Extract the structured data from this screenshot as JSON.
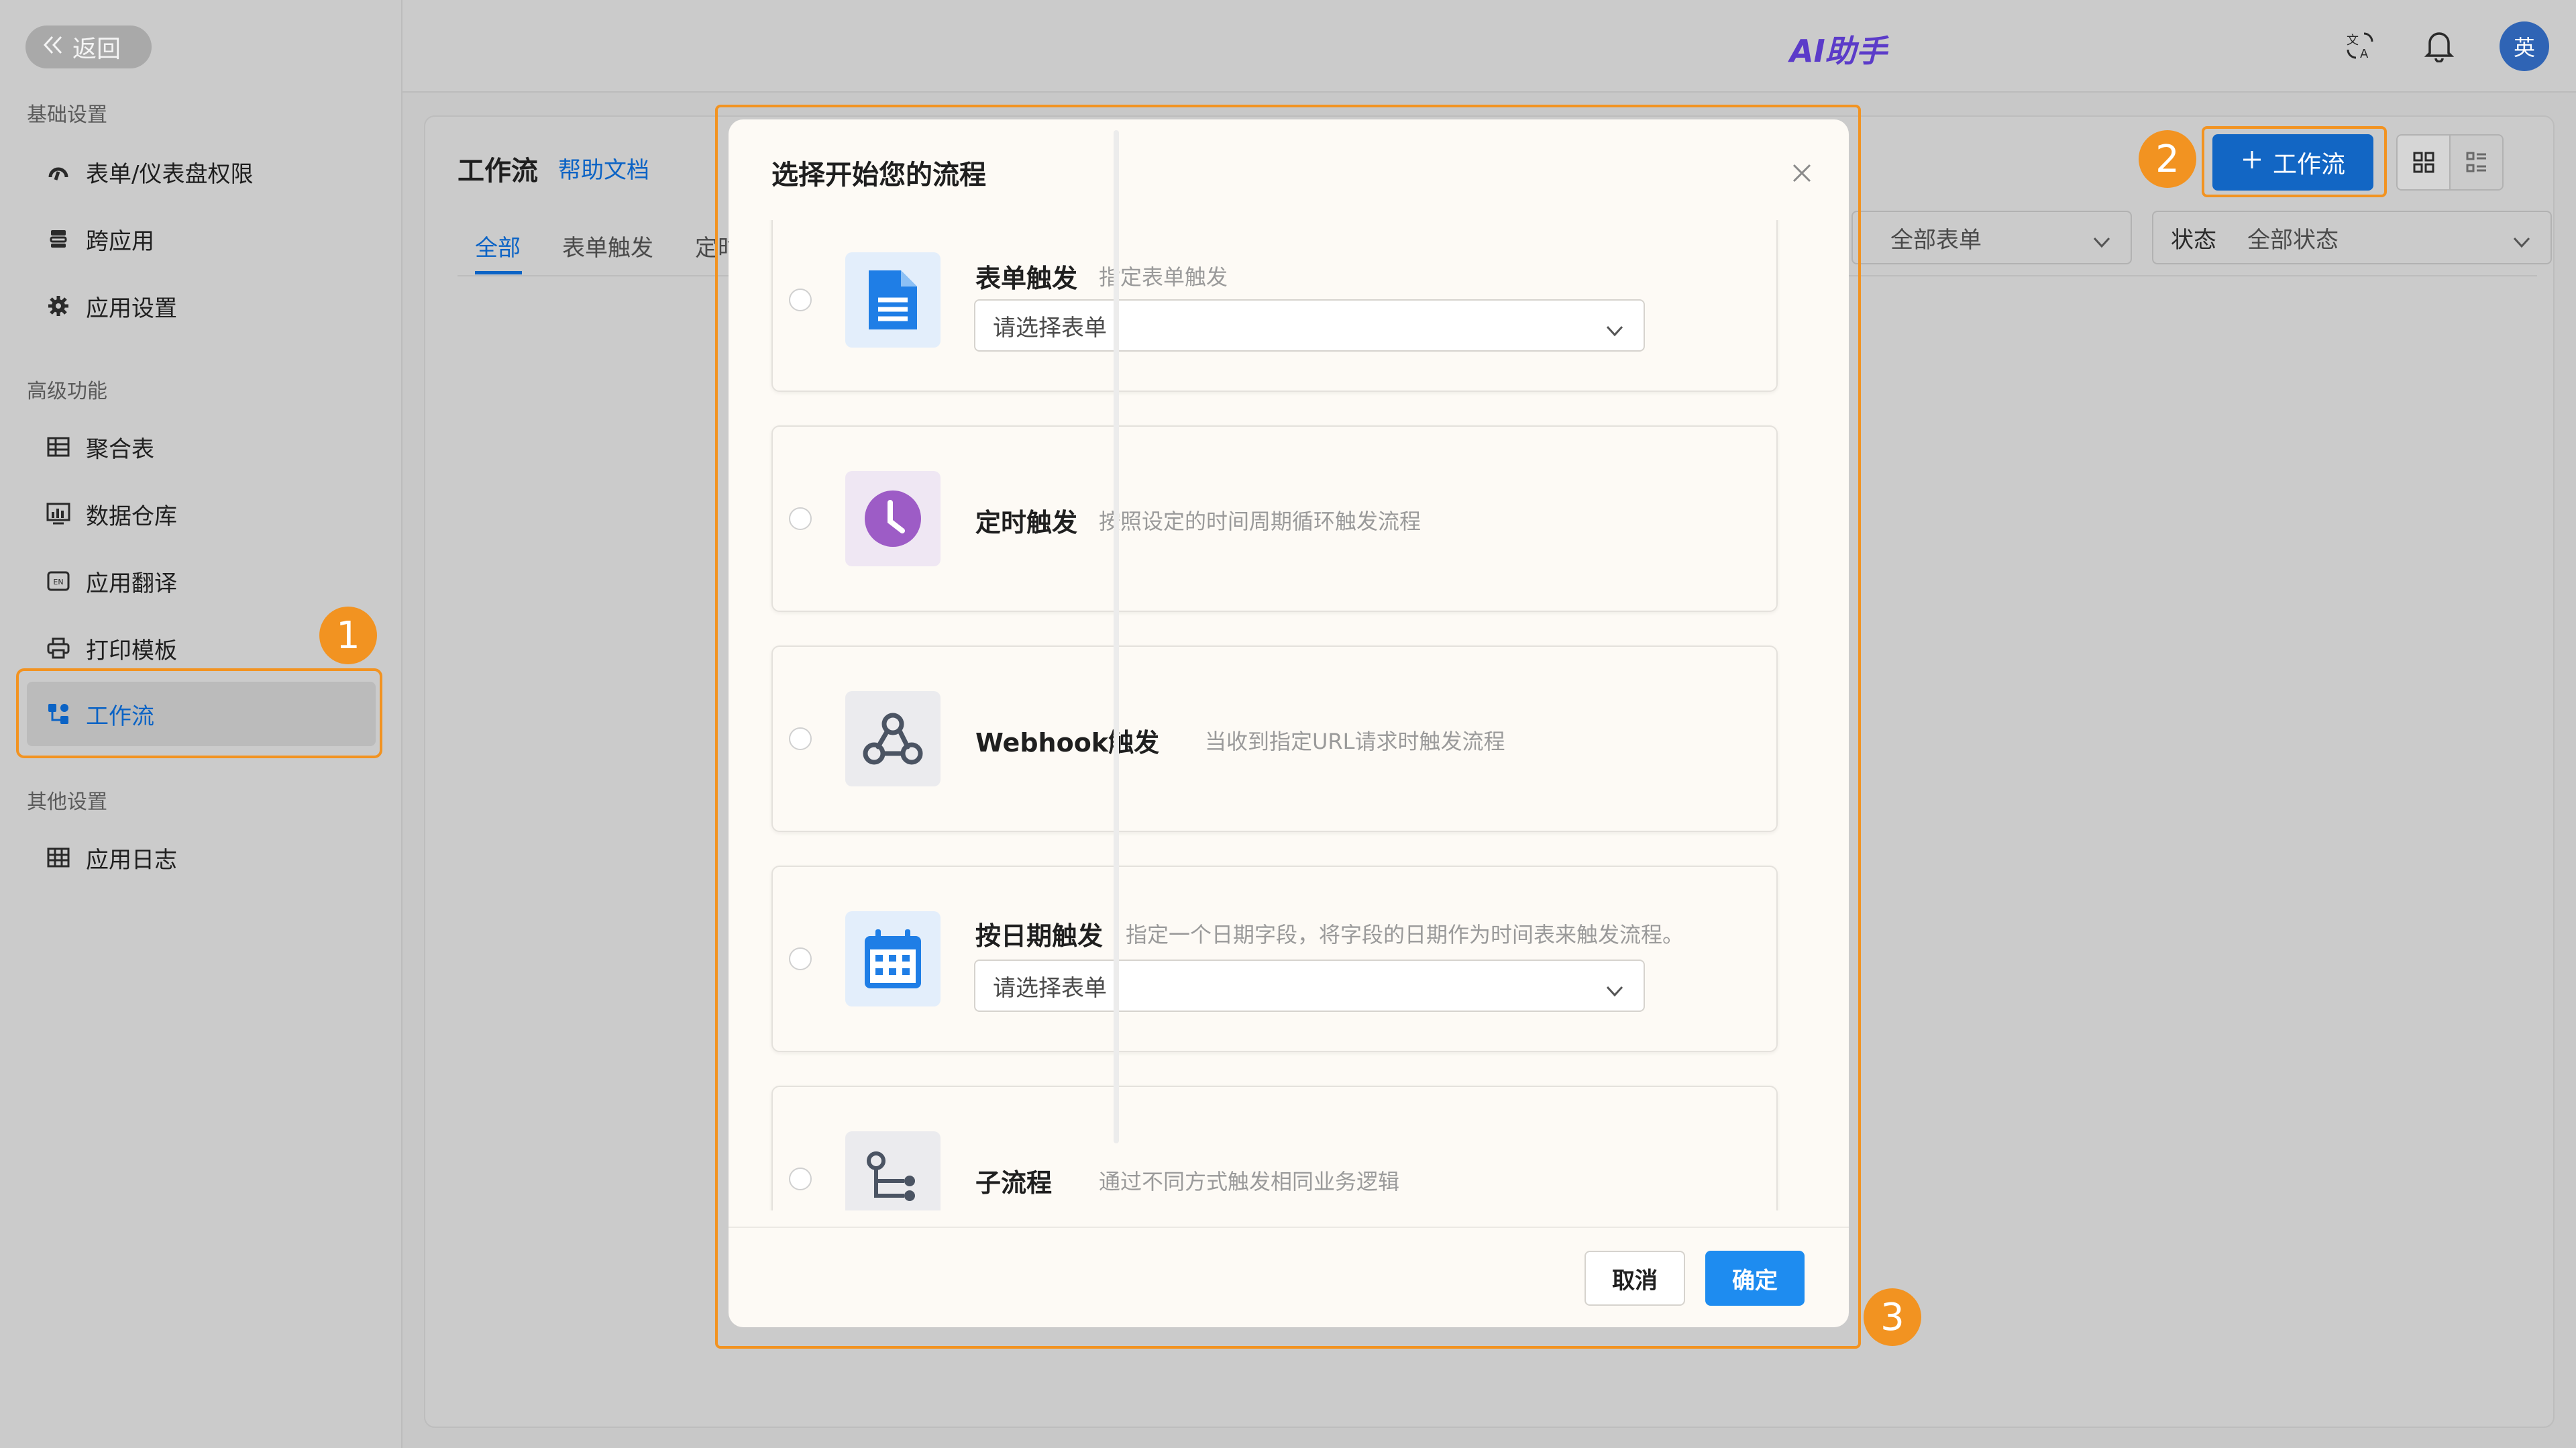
{
  "sidebar": {
    "back_label": "返回",
    "sections": [
      {
        "title": "基础设置"
      },
      {
        "title": "高级功能"
      },
      {
        "title": "其他设置"
      }
    ],
    "items": [
      {
        "label": "表单/仪表盘权限",
        "icon": "permission-icon"
      },
      {
        "label": "跨应用",
        "icon": "cross-app-icon"
      },
      {
        "label": "应用设置",
        "icon": "gear-icon"
      },
      {
        "label": "聚合表",
        "icon": "aggregate-table-icon"
      },
      {
        "label": "数据仓库",
        "icon": "data-warehouse-icon"
      },
      {
        "label": "应用翻译",
        "icon": "translate-icon"
      },
      {
        "label": "打印模板",
        "icon": "printer-icon"
      },
      {
        "label": "工作流",
        "icon": "workflow-icon",
        "active": true
      },
      {
        "label": "应用日志",
        "icon": "log-icon"
      }
    ]
  },
  "topbar": {
    "ai_label": "AI助手",
    "avatar_text": "英"
  },
  "main": {
    "title": "工作流",
    "help_link": "帮助文档",
    "tabs": [
      {
        "label": "全部",
        "active": true
      },
      {
        "label": "表单触发"
      },
      {
        "label": "定时"
      }
    ],
    "filter_form": "全部表单",
    "filter_status_label": "状态",
    "filter_status_value": "全部状态",
    "add_button": "工作流"
  },
  "modal": {
    "title": "选择开始您的流程",
    "options": [
      {
        "name": "表单触发",
        "desc": "指定表单触发",
        "select_placeholder": "请选择表单",
        "icon": "form-document-icon"
      },
      {
        "name": "定时触发",
        "desc": "按照设定的时间周期循环触发流程",
        "icon": "clock-icon"
      },
      {
        "name": "Webhook触发",
        "desc": "当收到指定URL请求时触发流程",
        "icon": "webhook-icon"
      },
      {
        "name": "按日期触发",
        "desc": "指定一个日期字段，将字段的日期作为时间表来触发流程。",
        "select_placeholder": "请选择表单",
        "icon": "calendar-icon"
      },
      {
        "name": "子流程",
        "desc": "通过不同方式触发相同业务逻辑",
        "icon": "subflow-icon"
      }
    ],
    "cancel": "取消",
    "confirm": "确定"
  },
  "annotations": {
    "badge1": "1",
    "badge2": "2",
    "badge3": "3"
  },
  "colors": {
    "highlight": "#f29321",
    "primary": "#1266c4",
    "confirm": "#1e8cf0"
  }
}
